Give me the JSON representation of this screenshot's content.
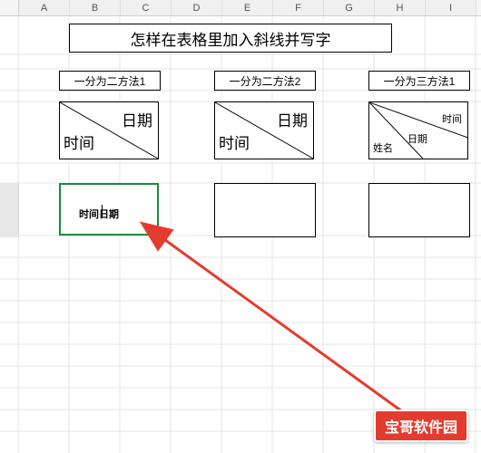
{
  "columns": [
    "A",
    "B",
    "C",
    "D",
    "E",
    "F",
    "G",
    "H",
    "I"
  ],
  "title": "怎样在表格里加入斜线并写字",
  "subheaders": {
    "a": "一分为二方法1",
    "b": "一分为二方法2",
    "c": "一分为三方法1"
  },
  "diag_labels": {
    "top_right": "日期",
    "bottom_left": "时间"
  },
  "tri_labels": {
    "top_right": "时间",
    "middle": "日期",
    "bottom_left": "姓名"
  },
  "editing_cell": {
    "text": "时间日期"
  },
  "watermark": "宝哥软件园"
}
